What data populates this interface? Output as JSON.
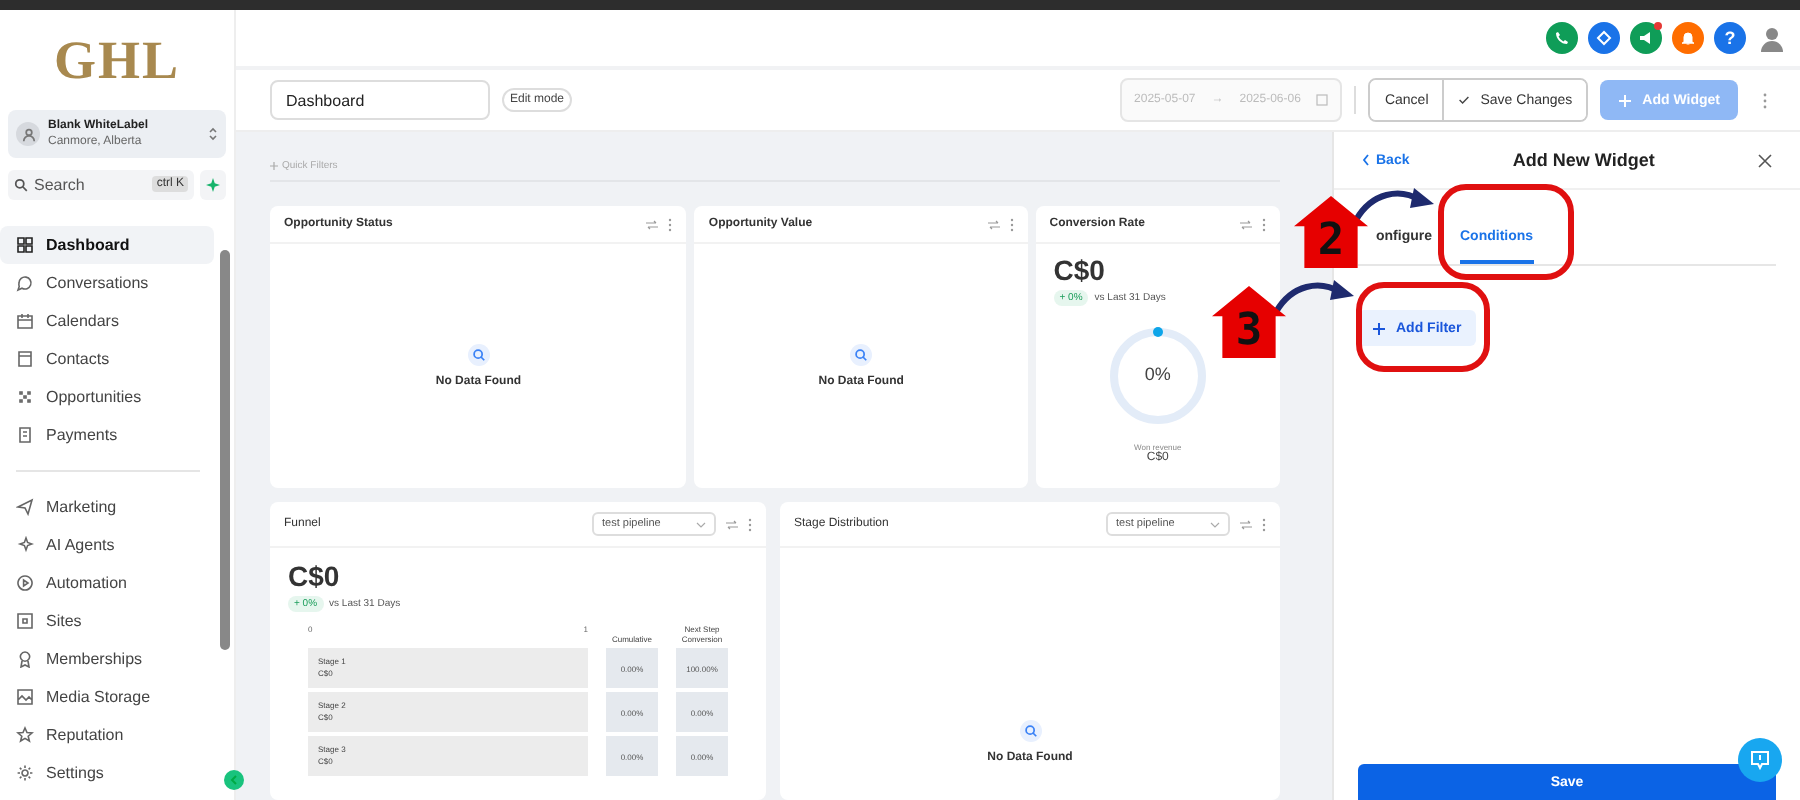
{
  "logo": "GHL",
  "account": {
    "name": "Blank WhiteLabel",
    "location": "Canmore, Alberta"
  },
  "search": {
    "placeholder": "Search",
    "shortcut": "ctrl K"
  },
  "nav_groups": [
    [
      {
        "label": "Dashboard",
        "selected": true
      },
      {
        "label": "Conversations",
        "selected": false
      },
      {
        "label": "Calendars",
        "selected": false
      },
      {
        "label": "Contacts",
        "selected": false
      },
      {
        "label": "Opportunities",
        "selected": false
      },
      {
        "label": "Payments",
        "selected": false
      }
    ],
    [
      {
        "label": "Marketing",
        "selected": false
      },
      {
        "label": "AI Agents",
        "selected": false
      },
      {
        "label": "Automation",
        "selected": false
      },
      {
        "label": "Sites",
        "selected": false
      },
      {
        "label": "Memberships",
        "selected": false
      },
      {
        "label": "Media Storage",
        "selected": false
      },
      {
        "label": "Reputation",
        "selected": false
      },
      {
        "label": "Settings",
        "selected": false
      }
    ]
  ],
  "header": {
    "help": "?"
  },
  "toolbar": {
    "dashboard_name": "Dashboard",
    "edit_mode": "Edit mode",
    "date_from": "2025-05-07",
    "date_separator": "→",
    "date_to": "2025-06-06",
    "cancel": "Cancel",
    "save_changes": "Save Changes",
    "add_widget": {
      "label": "Add Widget",
      "disabled": true
    }
  },
  "quick_filters": "Quick Filters",
  "widgets": [
    {
      "kind": "empty",
      "title": "Opportunity Status",
      "empty_text": "No Data Found"
    },
    {
      "kind": "empty",
      "title": "Opportunity Value",
      "empty_text": "No Data Found"
    },
    {
      "kind": "conversion",
      "title": "Conversion Rate",
      "value": "C$0",
      "change": "+ 0%",
      "comparison": "vs Last 31 Days",
      "level": 0,
      "percent": "0%",
      "won_label": "Won revenue",
      "won_value": "C$0"
    },
    {
      "kind": "funnel",
      "title": "Funnel",
      "pipeline": "test pipeline",
      "value": "C$0",
      "change": "+ 0%",
      "comparison": "vs Last 31 Days",
      "axis_start": "0",
      "axis_end": "1",
      "columns": [
        "Cumulative",
        "Next Step Conversion"
      ],
      "stages": [
        {
          "name": "Stage 1",
          "value": "C$0",
          "cumulative": "0.00%",
          "next": "100.00%"
        },
        {
          "name": "Stage 2",
          "value": "C$0",
          "cumulative": "0.00%",
          "next": "0.00%"
        },
        {
          "name": "Stage 3",
          "value": "C$0",
          "cumulative": "0.00%",
          "next": "0.00%"
        }
      ]
    },
    {
      "kind": "empty",
      "title": "Stage Distribution",
      "pipeline": "test pipeline",
      "empty_text": "No Data Found"
    }
  ],
  "panel": {
    "back": "Back",
    "title": "Add New Widget",
    "tabs": [
      {
        "label": "onfigure",
        "selected": false
      },
      {
        "label": "Conditions",
        "selected": true
      }
    ],
    "add_filter": "Add Filter",
    "save": "Save"
  },
  "annotations": [
    {
      "number": "2"
    },
    {
      "number": "3"
    }
  ]
}
